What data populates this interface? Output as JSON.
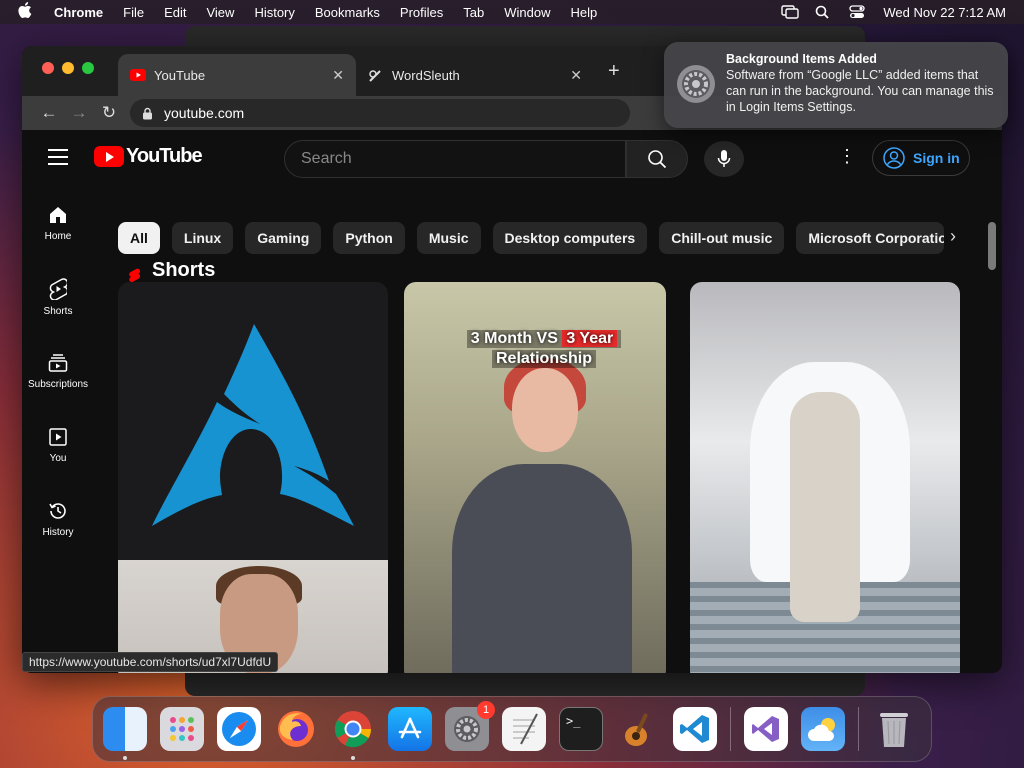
{
  "menubar": {
    "app_name": "Chrome",
    "items": [
      "File",
      "Edit",
      "View",
      "History",
      "Bookmarks",
      "Profiles",
      "Tab",
      "Window",
      "Help"
    ],
    "datetime": "Wed Nov 22  7:12 AM"
  },
  "browser": {
    "tabs": [
      {
        "title": "YouTube",
        "active": true
      },
      {
        "title": "WordSleuth",
        "active": false
      }
    ],
    "new_tab": "+",
    "url": "youtube.com",
    "status_url": "https://www.youtube.com/shorts/ud7xl7UdfdU"
  },
  "youtube": {
    "logo_text": "YouTube",
    "search_placeholder": "Search",
    "sign_in": "Sign in",
    "guide": [
      {
        "label": "Home",
        "icon": "home-icon"
      },
      {
        "label": "Shorts",
        "icon": "shorts-icon"
      },
      {
        "label": "Subscriptions",
        "icon": "subscriptions-icon"
      },
      {
        "label": "You",
        "icon": "you-icon"
      },
      {
        "label": "History",
        "icon": "history-icon"
      }
    ],
    "chips": [
      "All",
      "Linux",
      "Gaming",
      "Python",
      "Music",
      "Desktop computers",
      "Chill-out music",
      "Microsoft Corporation"
    ],
    "section_title": "Shorts",
    "shorts": [
      {
        "overlay_line1": "",
        "overlay_line2": ""
      },
      {
        "overlay_line1a": "3 Month VS",
        "overlay_line1b": "3 Year",
        "overlay_line2": "Relationship"
      },
      {}
    ]
  },
  "notification": {
    "title": "Background Items Added",
    "body": "Software from “Google LLC” added items that can run in the background. You can manage this in Login Items Settings."
  },
  "dock": {
    "apps": [
      "finder-icon",
      "launchpad-icon",
      "safari-icon",
      "firefox-icon",
      "chrome-icon",
      "app-store-icon",
      "system-settings-icon",
      "textedit-icon",
      "terminal-icon",
      "garageband-icon",
      "vscode-icon",
      "visual-studio-icon",
      "weather-icon",
      "trash-icon"
    ],
    "system_settings_badge": "1"
  },
  "colors": {
    "yt_red": "#ff0000",
    "link_blue": "#3ea6ff",
    "arch_blue": "#1793d1"
  }
}
